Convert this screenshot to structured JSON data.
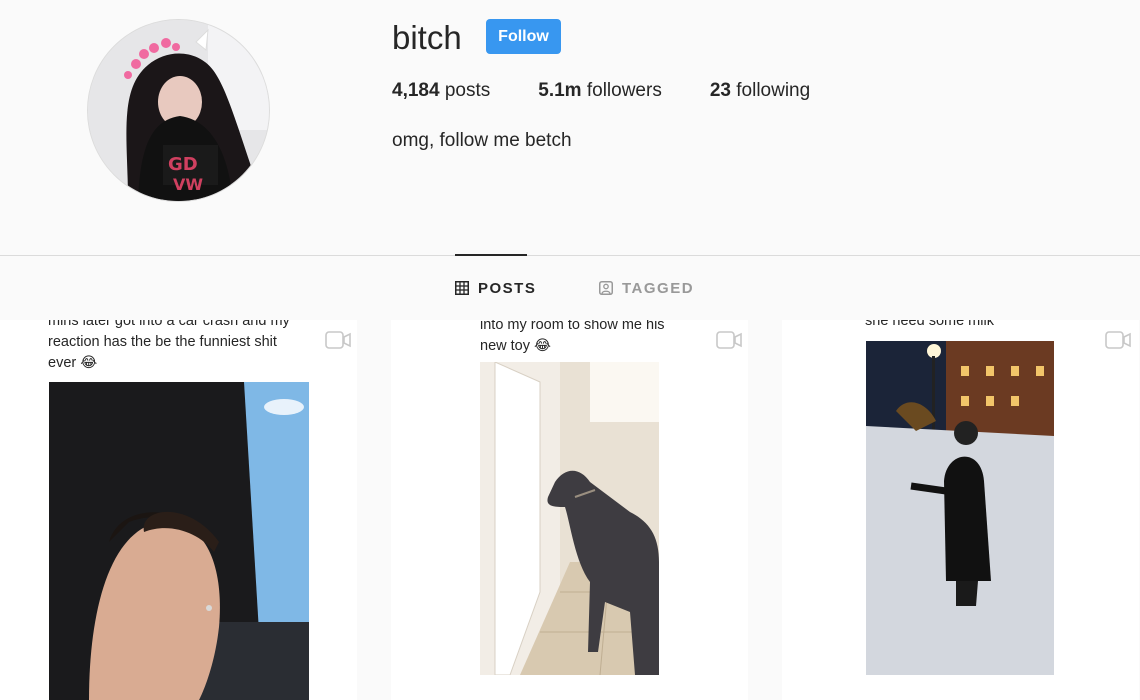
{
  "profile": {
    "username": "bitch",
    "follow_label": "Follow",
    "posts_count": "4,184",
    "posts_label": "posts",
    "followers_count": "5.1m",
    "followers_label": "followers",
    "following_count": "23",
    "following_label": "following",
    "bio": "omg, follow me betch",
    "avatar_icon": "profile-photo"
  },
  "tabs": [
    {
      "label": "POSTS",
      "icon": "grid-icon",
      "active": true
    },
    {
      "label": "TAGGED",
      "icon": "tagged-user-icon",
      "active": false
    }
  ],
  "posts": [
    {
      "caption_lines": [
        "mins later got into a car crash and my",
        "reaction has the be the funniest shit",
        "ever 😂"
      ],
      "media": "video",
      "icon": "video-icon"
    },
    {
      "caption_lines": [
        "into my room to show me his",
        "new toy 😂"
      ],
      "media": "video",
      "icon": "video-icon"
    },
    {
      "caption_lines": [
        "she need some milk"
      ],
      "media": "video",
      "icon": "video-icon"
    }
  ],
  "colors": {
    "accent": "#3897f0",
    "text": "#262626",
    "muted": "#999999",
    "background": "#fafafa"
  }
}
